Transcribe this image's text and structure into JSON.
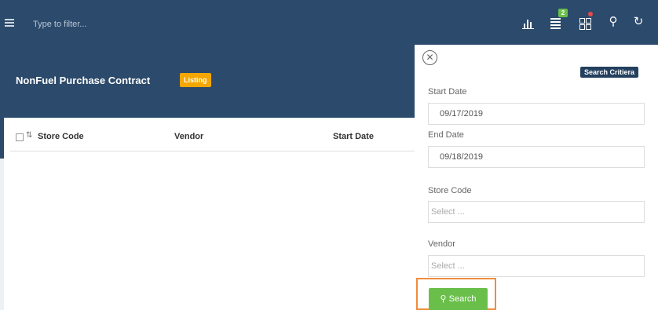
{
  "topbar": {
    "filter_placeholder": "Type to filter...",
    "badge_count": "2"
  },
  "page": {
    "title": "NonFuel Purchase Contract",
    "badge": "Listing"
  },
  "table": {
    "columns": [
      "Store Code",
      "Vendor",
      "Start Date"
    ]
  },
  "search_panel": {
    "badge": "Search Critiera",
    "start_date_label": "Start Date",
    "start_date_value": "09/17/2019",
    "end_date_label": "End Date",
    "end_date_value": "09/18/2019",
    "store_code_label": "Store Code",
    "store_code_placeholder": "Select ...",
    "vendor_label": "Vendor",
    "vendor_placeholder": "Select ...",
    "search_button": "Search"
  },
  "colors": {
    "navy": "#2c4a6b",
    "listing_badge": "#f4a700",
    "search_button": "#6abf4b",
    "highlight_outline": "#f08c3c",
    "notification_dot": "#e34b4b"
  },
  "icons": [
    "menu-icon",
    "bar-chart-icon",
    "stack-icon",
    "grid-icon",
    "search-icon",
    "refresh-icon",
    "close-icon",
    "sort-icon",
    "magnifier-icon"
  ]
}
